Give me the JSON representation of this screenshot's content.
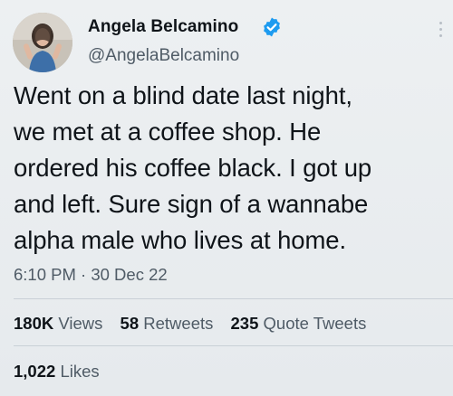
{
  "tweet": {
    "author": {
      "display_name": "Angela Belcamino",
      "handle": "@AngelaBelcamino",
      "verified_icon": "verified-badge-icon",
      "avatar_icon": "profile-photo"
    },
    "text_lines": [
      "Went on a blind date last night,",
      "we met at a coffee shop. He",
      "ordered his coffee black. I got up",
      "and left. Sure sign of a wannabe",
      "alpha male who lives at home."
    ],
    "timestamp": "6:10 PM · 30 Dec 22",
    "stats": {
      "views_count": "180K",
      "views_label": "Views",
      "retweets_count": "58",
      "retweets_label": "Retweets",
      "quotes_count": "235",
      "quotes_label": "Quote Tweets",
      "likes_count": "1,022",
      "likes_label": "Likes"
    }
  },
  "colors": {
    "accent": "#1d9bf0",
    "text": "#0f1419",
    "secondary_text": "#4f5b66",
    "background": "#eaeef1"
  }
}
